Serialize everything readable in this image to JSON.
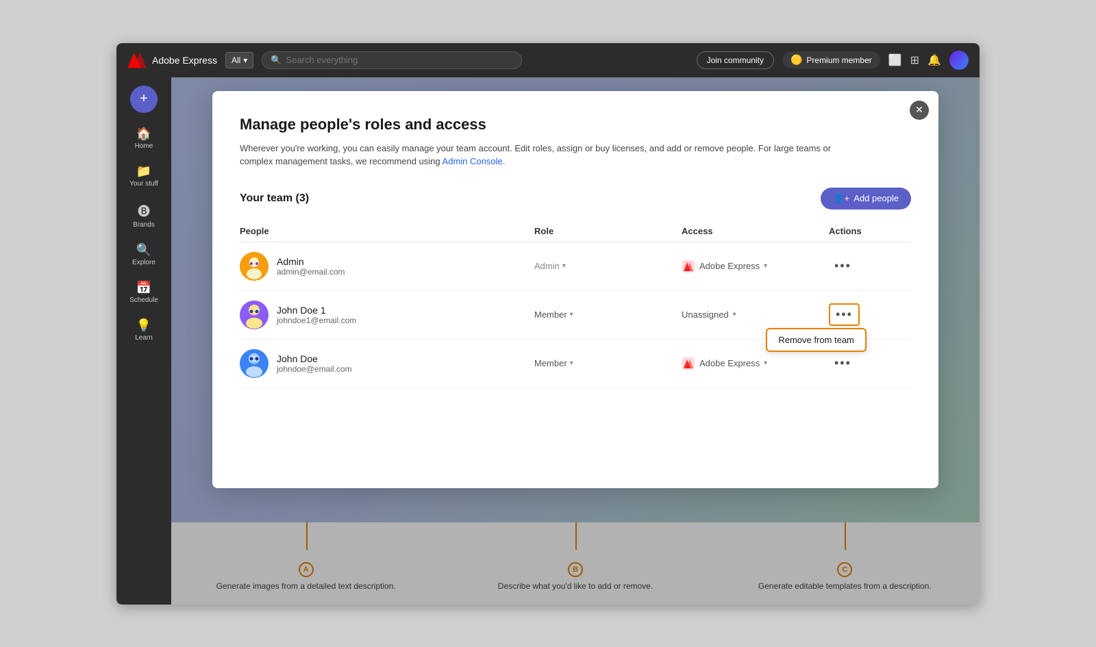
{
  "app": {
    "title": "Adobe Express",
    "nav_dropdown": "All",
    "search_placeholder": "Search everything",
    "join_community": "Join community",
    "premium_member": "Premium member"
  },
  "sidebar": {
    "items": [
      {
        "label": "Home",
        "icon": "🏠"
      },
      {
        "label": "Your stuff",
        "icon": "📁"
      },
      {
        "label": "Brands",
        "icon": "🅑"
      },
      {
        "label": "Explore",
        "icon": "🔍"
      },
      {
        "label": "Schedule",
        "icon": "📅"
      },
      {
        "label": "Learn",
        "icon": "💡"
      }
    ]
  },
  "modal": {
    "title": "Manage people's roles and access",
    "description": "Wherever you're working, you can easily manage your team account. Edit roles, assign or buy licenses, and add or remove people. For large teams or complex management tasks, we recommend using",
    "admin_console_link": "Admin Console",
    "team_title": "Your team (3)",
    "add_people_btn": "Add people",
    "columns": {
      "people": "People",
      "role": "Role",
      "access": "Access",
      "actions": "Actions"
    },
    "members": [
      {
        "name": "Admin",
        "email": "admin@email.com",
        "role": "Admin",
        "access": "Adobe Express",
        "has_access_icon": true,
        "highlighted": false
      },
      {
        "name": "John Doe 1",
        "email": "johndoe1@email.com",
        "role": "Member",
        "access": "Unassigned",
        "has_access_icon": false,
        "highlighted": true
      },
      {
        "name": "John Doe",
        "email": "johndoe@email.com",
        "role": "Member",
        "access": "Adobe Express",
        "has_access_icon": true,
        "highlighted": false
      }
    ],
    "context_menu_item": "Remove from team"
  },
  "annotations": [
    {
      "letter": "A",
      "text": "Generate images from a detailed text description."
    },
    {
      "letter": "B",
      "text": "Describe what you'd like to add or remove."
    },
    {
      "letter": "C",
      "text": "Generate editable templates from a description."
    }
  ]
}
